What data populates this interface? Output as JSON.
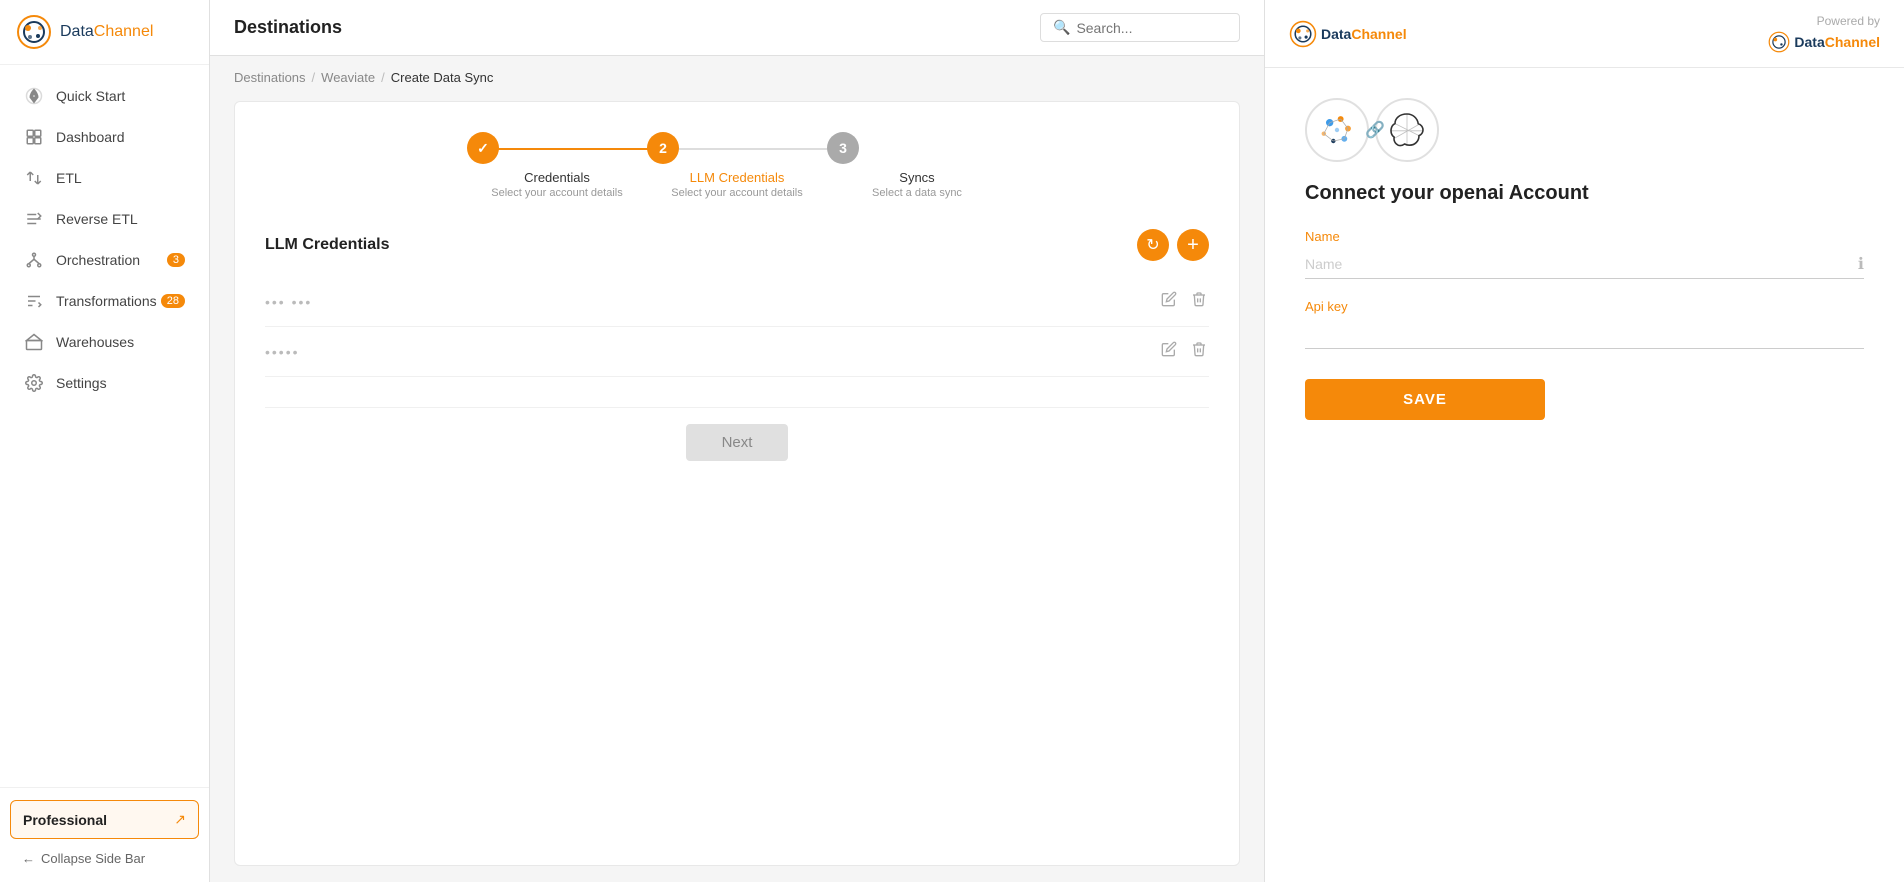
{
  "sidebar": {
    "logo": {
      "data": "Data",
      "channel": "Channel"
    },
    "nav_items": [
      {
        "id": "quick-start",
        "label": "Quick Start",
        "icon": "rocket"
      },
      {
        "id": "dashboard",
        "label": "Dashboard",
        "icon": "grid"
      },
      {
        "id": "etl",
        "label": "ETL",
        "icon": "arrows"
      },
      {
        "id": "reverse-etl",
        "label": "Reverse ETL",
        "icon": "reverse"
      },
      {
        "id": "orchestration",
        "label": "Orchestration",
        "icon": "orchestration",
        "badge": "3"
      },
      {
        "id": "transformations",
        "label": "Transformations",
        "icon": "transformations",
        "badge": "28"
      },
      {
        "id": "warehouses",
        "label": "Warehouses",
        "icon": "warehouse"
      },
      {
        "id": "settings",
        "label": "Settings",
        "icon": "gear"
      }
    ],
    "professional": {
      "label": "Professional",
      "icon": "↗"
    },
    "collapse_label": "Collapse Side Bar"
  },
  "header": {
    "title": "Destinations",
    "search_placeholder": "Search..."
  },
  "breadcrumb": {
    "items": [
      "Destinations",
      "Weaviate",
      "Create Data Sync"
    ]
  },
  "wizard": {
    "steps": [
      {
        "number": "✓",
        "label": "Credentials",
        "sub": "Select your account details",
        "state": "done"
      },
      {
        "number": "2",
        "label": "LLM Credentials",
        "sub": "Select your account details",
        "state": "active"
      },
      {
        "number": "3",
        "label": "Syncs",
        "sub": "Select a data sync",
        "state": "pending"
      }
    ],
    "section_title": "LLM Credentials",
    "credentials": [
      {
        "id": "cred1",
        "masked": "••• •••"
      },
      {
        "id": "cred2",
        "masked": "•••••"
      }
    ],
    "next_button": "Next"
  },
  "right_panel": {
    "header": {
      "powered_by": "Powered by"
    },
    "connect_title": "Connect your openai Account",
    "form": {
      "name_label": "Name",
      "name_placeholder": "Name",
      "api_key_label": "Api key",
      "api_key_placeholder": "",
      "save_button": "SAVE"
    }
  }
}
